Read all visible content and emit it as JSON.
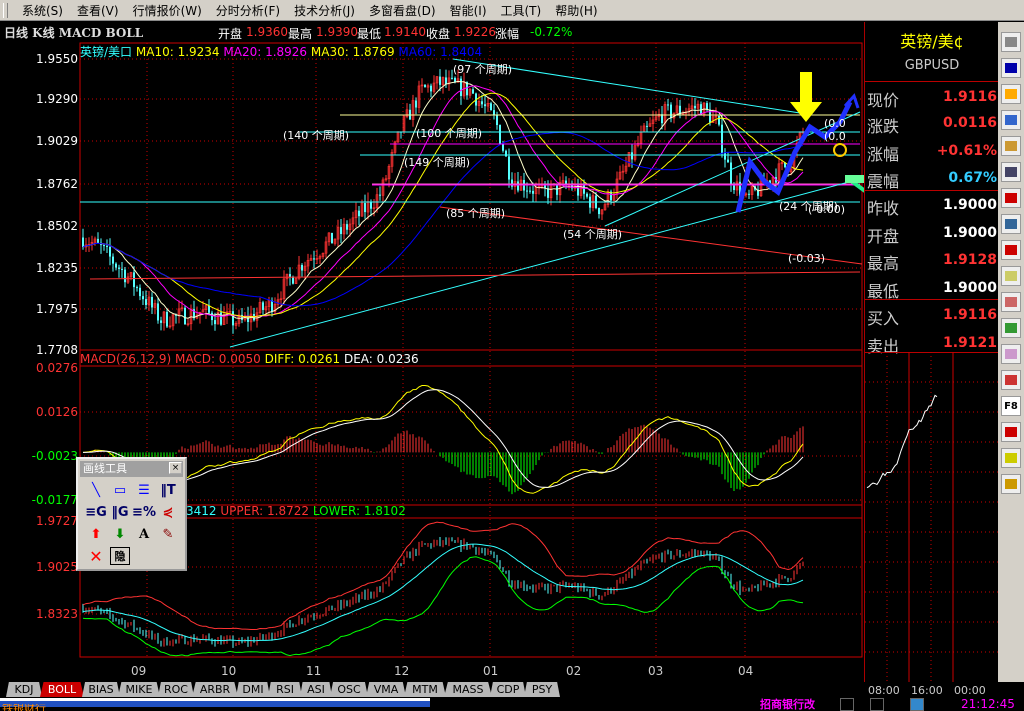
{
  "menu": [
    "系统(S)",
    "查看(V)",
    "行情报价(W)",
    "分时分析(F)",
    "技术分析(J)",
    "多窗看盘(D)",
    "智能(I)",
    "工具(T)",
    "帮助(H)"
  ],
  "header": {
    "title": "日线 K线 MACD BOLL",
    "open_label": "开盘",
    "open": "1.9360",
    "high_label": "最高",
    "high": "1.9390",
    "low_label": "最低",
    "low": "1.9140",
    "close_label": "收盘",
    "close": "1.9226",
    "change_label": "涨幅",
    "change": "-0.72%"
  },
  "price_pane": {
    "symbol": "英镑/美口",
    "ma10": "MA10: 1.9234",
    "ma20": "MA20: 1.8926",
    "ma30": "MA30: 1.8769",
    "ma60": "MA60: 1.8404",
    "ticks": [
      "1.9550",
      "1.9290",
      "1.9029",
      "1.8762",
      "1.8502",
      "1.8235",
      "1.7975",
      "1.7708"
    ],
    "annotations": [
      "(97 个周期)",
      "(140 个周期)",
      "(100 个周期)",
      "(149 个周期)",
      "(85 个周期)",
      "(54 个周期)",
      "(24 个周期)",
      "(-0.03)",
      "(-0.00)",
      "(0.0",
      "(0.0"
    ]
  },
  "macd_pane": {
    "name": "MACD(26,12,9)",
    "macd": "MACD: 0.0050",
    "diff": "DIFF: 0.0261",
    "dea": "DEA: 0.0236",
    "ticks": [
      "0.0276",
      "0.0126",
      "-0.0023",
      "-0.0177"
    ]
  },
  "boll_pane": {
    "mid_fragment": "3412",
    "upper": "UPPER: 1.8722",
    "lower": "LOWER: 1.8102",
    "ticks": [
      "1.9727",
      "1.9025",
      "1.8323"
    ]
  },
  "x_labels": [
    "09",
    "10",
    "11",
    "12",
    "01",
    "02",
    "03",
    "04"
  ],
  "drawing_toolbox": {
    "title": "画线工具",
    "close": "×",
    "text_tool": "A",
    "hide_tool": "隐"
  },
  "quote_panel": {
    "name": "英镑/美¢",
    "code": "GBPUSD",
    "rows": [
      {
        "label": "现价",
        "value": "1.9116",
        "color": "#ff3333"
      },
      {
        "label": "涨跌",
        "value": "0.0116",
        "color": "#ff3333"
      },
      {
        "label": "涨幅",
        "value": "+0.61%",
        "color": "#ff3333"
      },
      {
        "label": "震幅",
        "value": "0.67%",
        "color": "#33ccff"
      },
      {
        "label": "昨收",
        "value": "1.9000",
        "color": "#ffffff"
      },
      {
        "label": "开盘",
        "value": "1.9000",
        "color": "#ffffff"
      },
      {
        "label": "最高",
        "value": "1.9128",
        "color": "#ff3333"
      },
      {
        "label": "最低",
        "value": "1.9000",
        "color": "#ffffff"
      },
      {
        "label": "买入",
        "value": "1.9116",
        "color": "#ff3333"
      },
      {
        "label": "卖出",
        "value": "1.9121",
        "color": "#ff3333"
      }
    ],
    "time_labels": [
      "08:00",
      "16:00",
      "00:00"
    ]
  },
  "toolbar_icons": [
    "gear-icon",
    "bracket-icon",
    "back-arrow-icon",
    "report-icon",
    "list-icon",
    "table-icon",
    "line-chart-icon",
    "print-icon",
    "candlestick-icon",
    "chart-window-icon",
    "curve-icon",
    "columns-icon",
    "link-icon",
    "multi-chart-icon",
    "f8-icon",
    "save-icon",
    "pencil-icon",
    "search-icon"
  ],
  "toolbar_f8": "F8",
  "tabs": [
    "KDJ",
    "BOLL",
    "BIAS",
    "MIKE",
    "ROC",
    "ARBR",
    "DMI",
    "RSI",
    "ASI",
    "OSC",
    "VMA",
    "MTM",
    "MASS",
    "CDP",
    "PSY"
  ],
  "active_tab": "BOLL",
  "status": {
    "left": "铁银财行",
    "bank": "招商银行改",
    "time": "21:12:45"
  },
  "colors": {
    "up": "#ff3333",
    "down": "#55ffff",
    "grid": "#cc0000",
    "ma10": "#ffffcc",
    "ma20": "#ff00ff",
    "ma30": "#ffff00",
    "ma60": "#0000ff"
  }
}
